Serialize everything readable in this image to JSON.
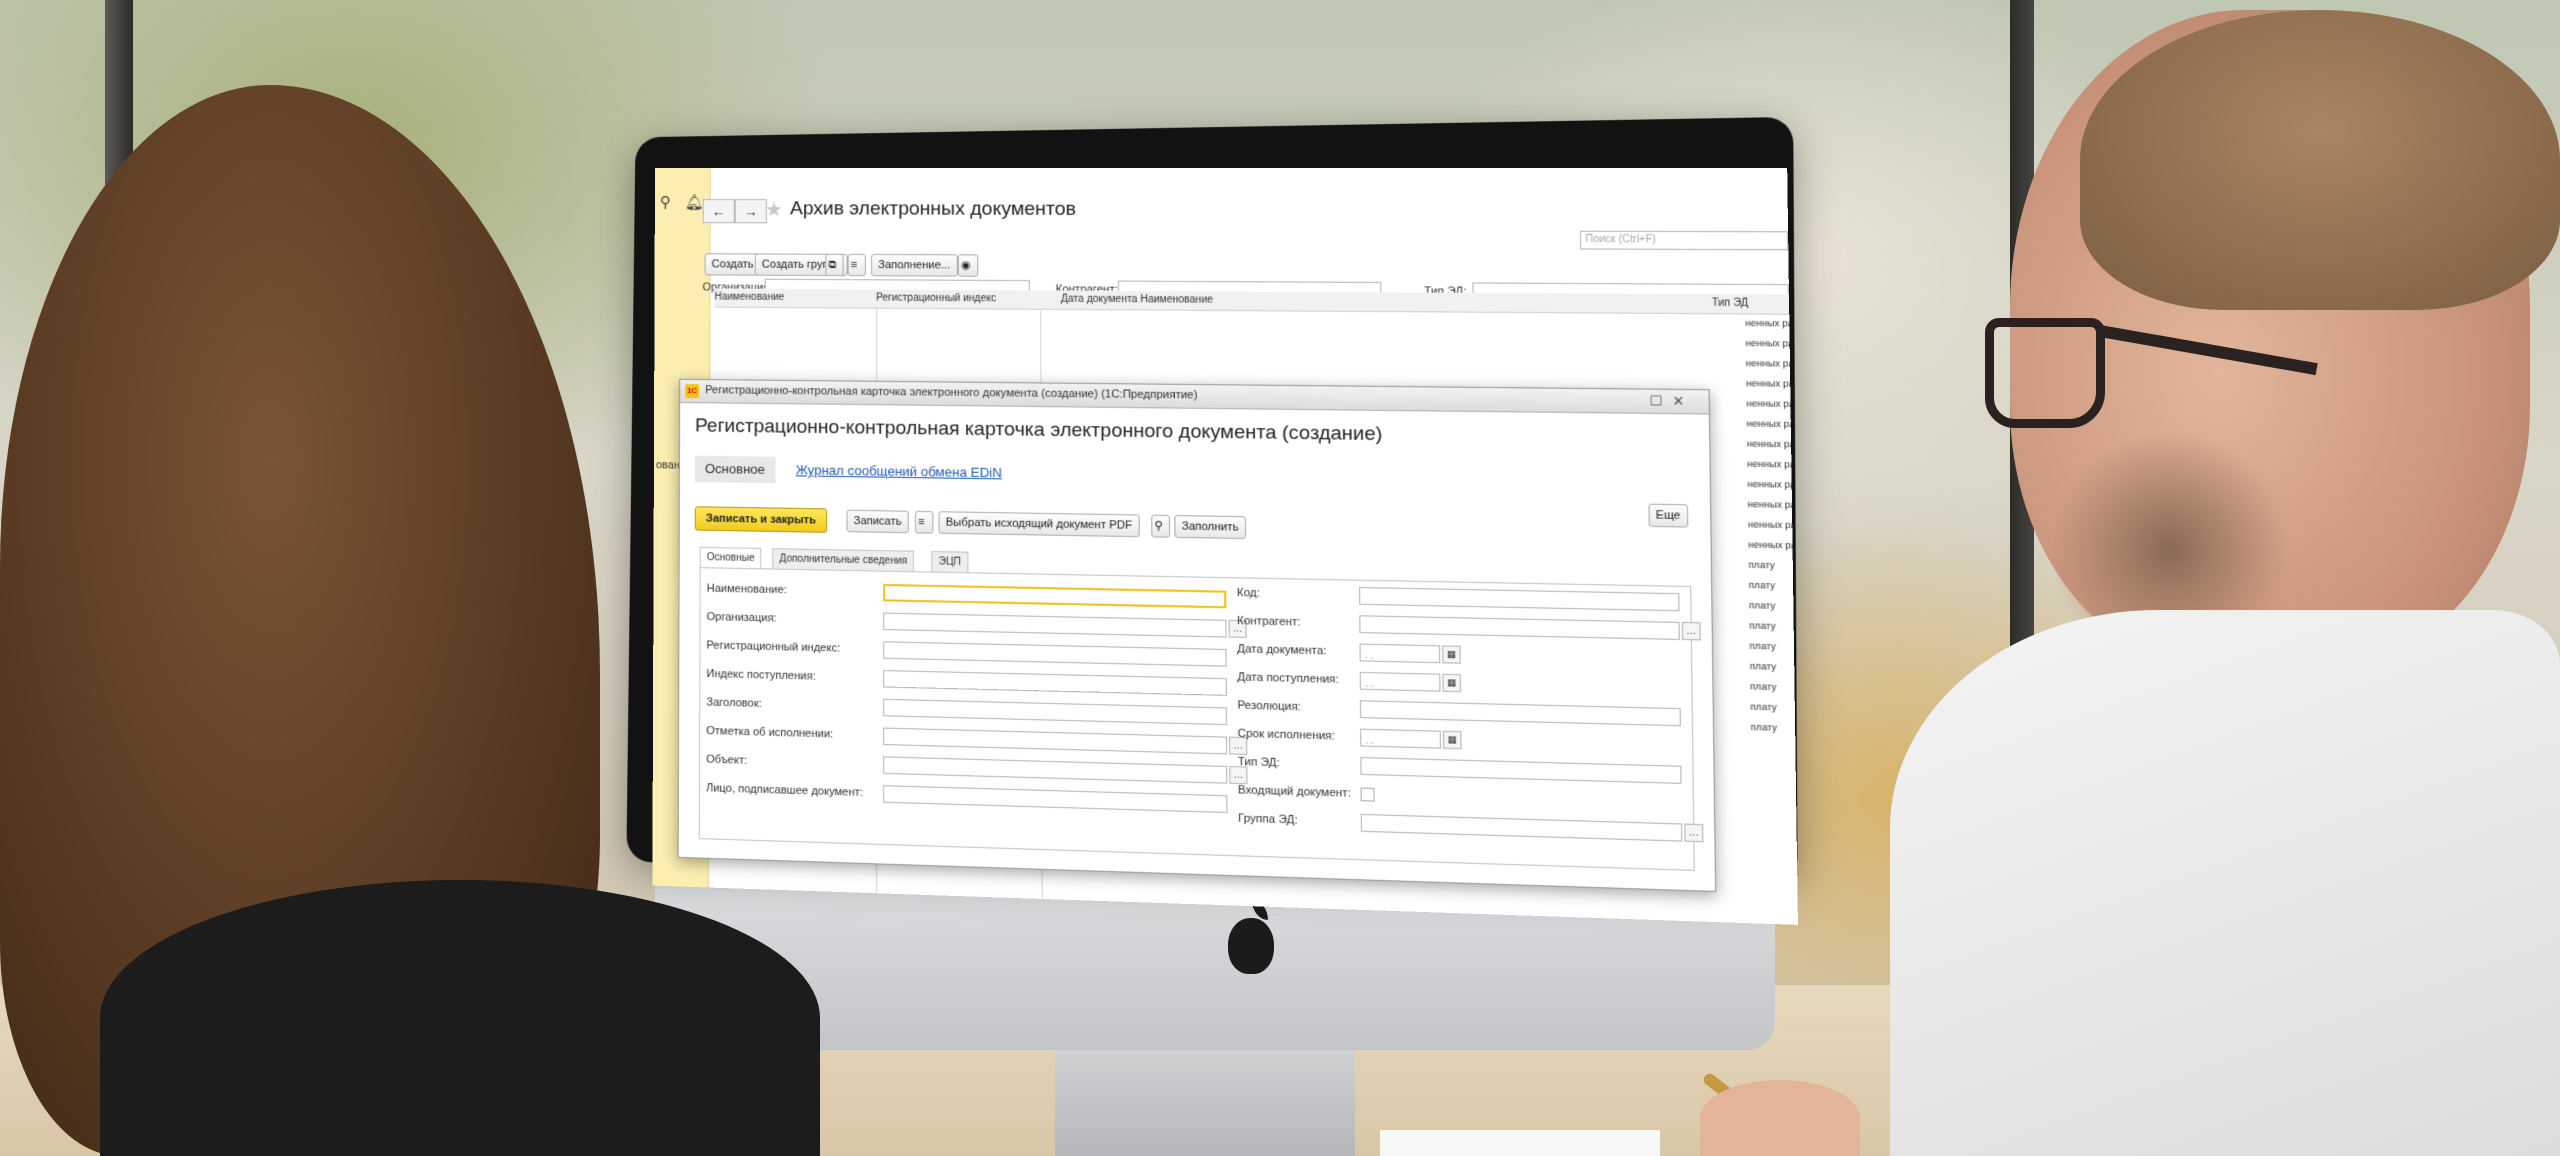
{
  "app": {
    "title": "Архив электронных документов",
    "nav_back": "←",
    "nav_forward": "→"
  },
  "toolbar": {
    "create": "Создать",
    "create_group": "Создать группу",
    "fill": "Заполнение...",
    "search_placeholder": "Поиск (Ctrl+F)"
  },
  "filters": {
    "organization_label": "Организация:",
    "counterparty_label": "Контрагент:",
    "doc_type_label": "Тип ЭД:"
  },
  "list_columns": {
    "name": "Наименование",
    "reg_index": "Регистрационный индекс",
    "doc_date_name": "Дата документа  Наименование",
    "doc_type": "Тип ЭД"
  },
  "list_rows": [
    "ненных раб",
    "ненных раб",
    "ненных раб",
    "ненных раб",
    "ненных раб",
    "ненных раб",
    "ненных раб",
    "ненных раб",
    "ненных раб",
    "ненных раб",
    "ненных раб",
    "ненных раб",
    "плату",
    "плату",
    "плату",
    "плату",
    "плату",
    "плату",
    "плату",
    "плату",
    "плату"
  ],
  "sidebar_cut_text": "овани",
  "modal": {
    "window_title": "Регистрационно-контрольная карточка электронного документа (создание)  (1С:Предприятие)",
    "heading": "Регистрационно-контрольная карточка электронного документа (создание)",
    "tab_main": "Основное",
    "tab_link": "Журнал сообщений обмена EDiN",
    "btn_save_close": "Записать и закрыть",
    "btn_save": "Записать",
    "btn_select_pdf": "Выбрать исходящий документ PDF",
    "btn_fill": "Заполнить",
    "btn_more": "Еще",
    "inner_tabs": [
      "Основные",
      "Дополнительные сведения",
      "ЭЦП"
    ],
    "left_fields": [
      "Наименование:",
      "Организация:",
      "Регистрационный индекс:",
      "Индекс поступления:",
      "Заголовок:",
      "Отметка об исполнении:",
      "Объект:",
      "Лицо, подписавшее документ:"
    ],
    "right_fields": [
      "Код:",
      "Контрагент:",
      "Дата документа:",
      "Дата поступления:",
      "Резолюция:",
      "Срок исполнения:",
      "Тип ЭД:",
      "Входящий документ:",
      "Группа ЭД:"
    ],
    "date_placeholder": ". ."
  },
  "icons": {
    "search": "search-icon",
    "bell": "bell-icon",
    "star": "star-icon",
    "one_c_logo": "1c-logo-icon"
  }
}
